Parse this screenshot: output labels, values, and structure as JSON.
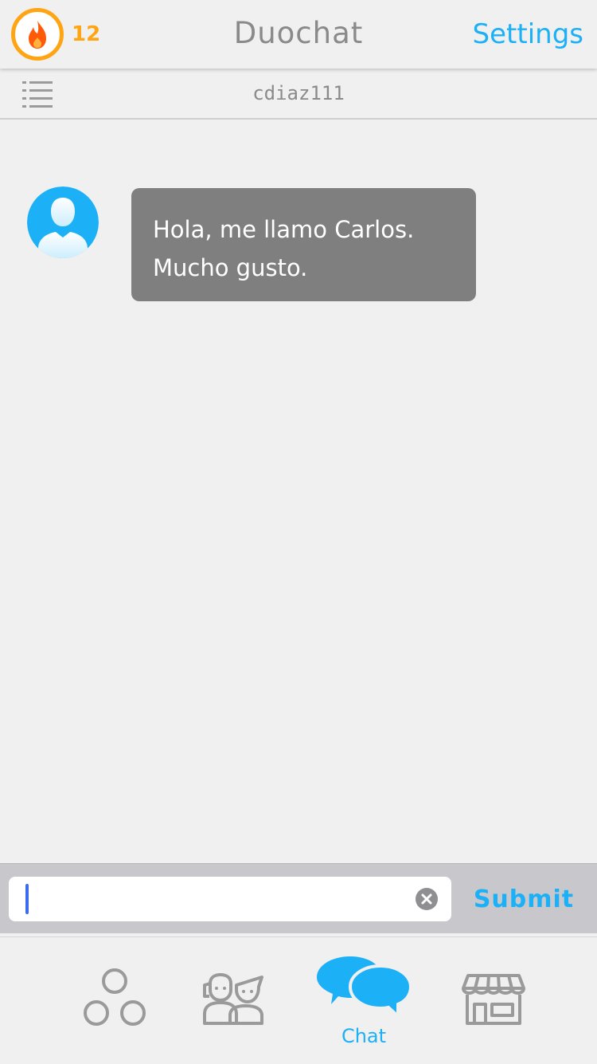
{
  "header": {
    "streak_count": "12",
    "title": "Duochat",
    "settings_label": "Settings"
  },
  "subheader": {
    "username": "cdiaz111"
  },
  "messages": [
    {
      "sender": "other",
      "lines": [
        "Hola, me llamo Carlos.",
        "Mucho gusto."
      ]
    }
  ],
  "composer": {
    "value": "",
    "submit_label": "Submit"
  },
  "tabs": [
    {
      "name": "circles",
      "icon": "circles-icon",
      "label": ""
    },
    {
      "name": "friends",
      "icon": "people-icon",
      "label": ""
    },
    {
      "name": "chat",
      "icon": "chat-bubbles-icon",
      "label": "Chat",
      "active": true
    },
    {
      "name": "store",
      "icon": "store-icon",
      "label": ""
    }
  ],
  "colors": {
    "accent": "#1cb0f6",
    "streak": "#ffa514",
    "flame": "#ff5a0a",
    "bubble": "#7f7f7f",
    "text_gray": "#8a8a8a",
    "icon_gray": "#9a9a9a"
  }
}
